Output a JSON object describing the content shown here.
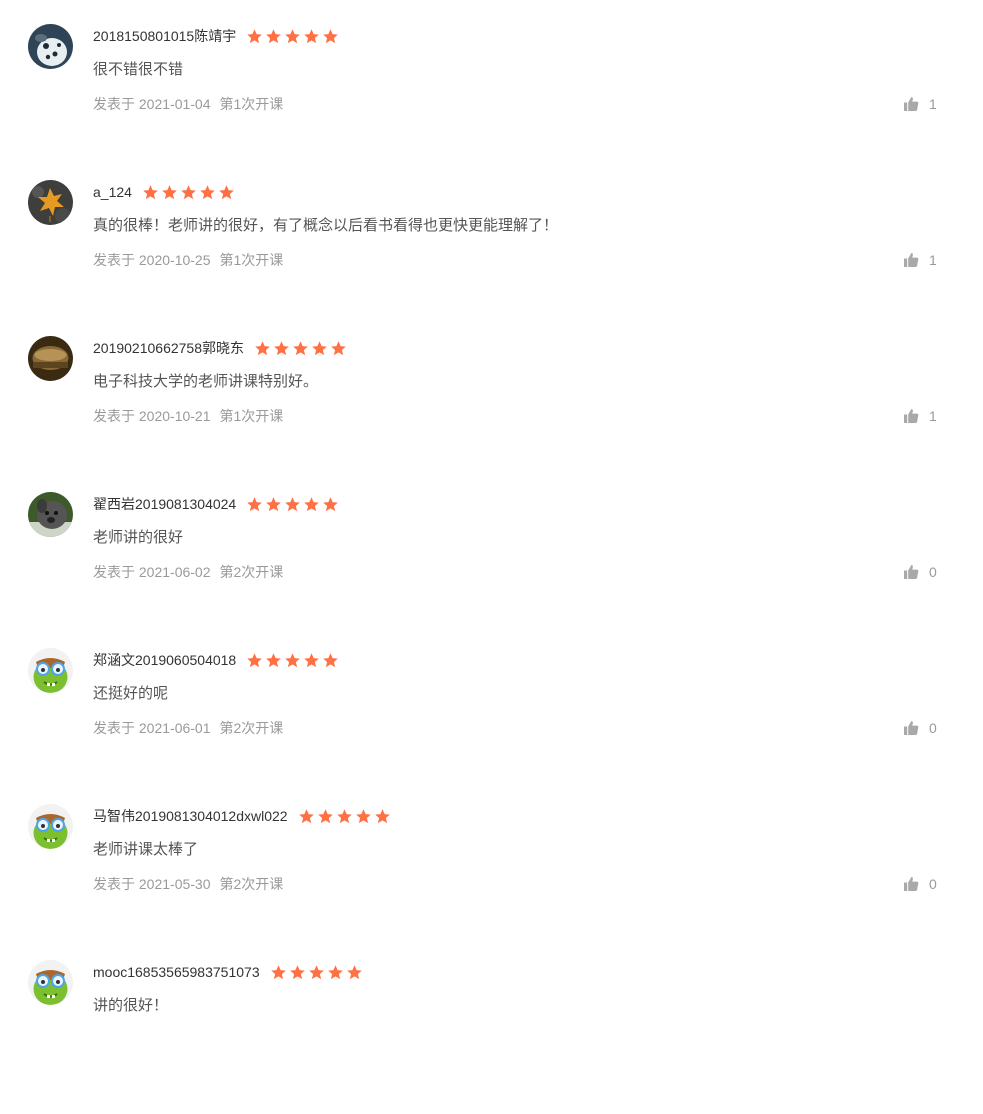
{
  "colors": {
    "star": "#ff7044",
    "meta": "#9a9a9a",
    "text": "#333333"
  },
  "icons": {
    "star": "star-icon",
    "like": "thumbs-up-icon"
  },
  "reviews": [
    {
      "username": "2018150801015陈靖宇",
      "rating": 5,
      "content": "很不错很不错",
      "date": "发表于 2021-01-04",
      "term": "第1次开课",
      "likes": "1",
      "avatar": "dalmatian"
    },
    {
      "username": "a_124",
      "rating": 5,
      "content": "真的很棒！老师讲的很好，有了概念以后看书看得也更快更能理解了！",
      "date": "发表于 2020-10-25",
      "term": "第1次开课",
      "likes": "1",
      "avatar": "leaf"
    },
    {
      "username": "20190210662758郭晓东",
      "rating": 5,
      "content": "电子科技大学的老师讲课特别好。",
      "date": "发表于 2020-10-21",
      "term": "第1次开课",
      "likes": "1",
      "avatar": "bronze"
    },
    {
      "username": "翟西岩2019081304024",
      "rating": 5,
      "content": "老师讲的很好",
      "date": "发表于 2021-06-02",
      "term": "第2次开课",
      "likes": "0",
      "avatar": "dog"
    },
    {
      "username": "郑涵文2019060504018",
      "rating": 5,
      "content": "还挺好的呢",
      "date": "发表于 2021-06-01",
      "term": "第2次开课",
      "likes": "0",
      "avatar": "monster"
    },
    {
      "username": "马智伟2019081304012dxwl022",
      "rating": 5,
      "content": "老师讲课太棒了",
      "date": "发表于 2021-05-30",
      "term": "第2次开课",
      "likes": "0",
      "avatar": "monster"
    },
    {
      "username": "mooc16853565983751073",
      "rating": 5,
      "content": "讲的很好！",
      "date": "",
      "term": "",
      "likes": "",
      "avatar": "monster"
    }
  ]
}
